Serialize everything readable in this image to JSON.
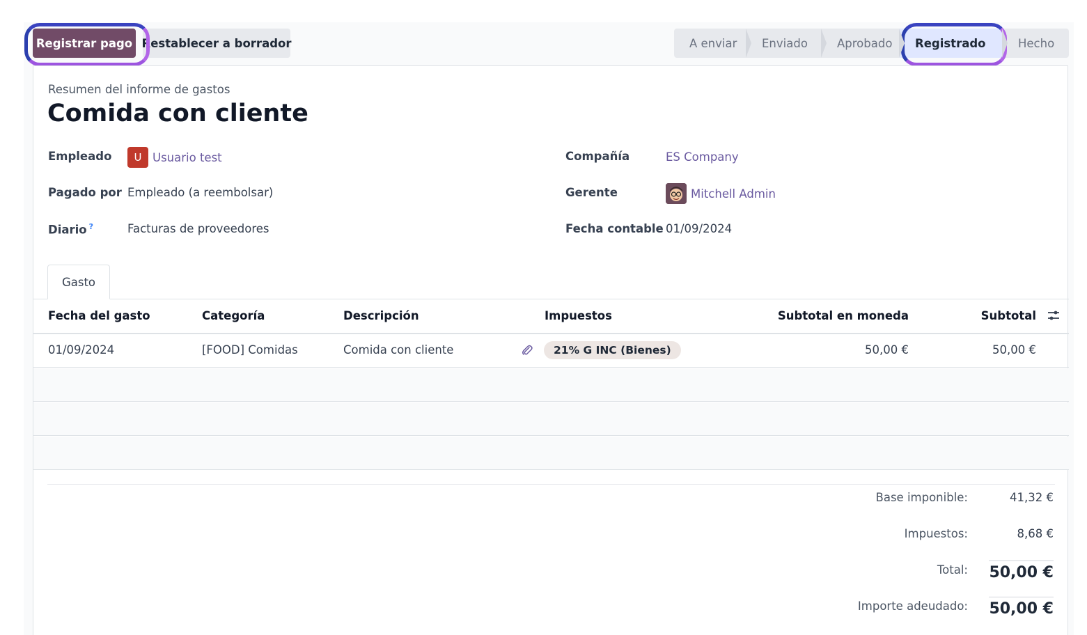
{
  "toolbar": {
    "register_payment": "Registrar pago",
    "reset_to_draft": "Restablecer a borrador"
  },
  "status_bar": {
    "stages": [
      "A enviar",
      "Enviado",
      "Aprobado",
      "Registrado",
      "Hecho"
    ],
    "active": "Registrado"
  },
  "form": {
    "subtitle": "Resumen del informe de gastos",
    "title": "Comida con cliente",
    "fields_left": {
      "employee_label": "Empleado",
      "employee_initial": "U",
      "employee_value": "Usuario test",
      "paid_by_label": "Pagado por",
      "paid_by_value": "Empleado (a reembolsar)",
      "journal_label": "Diario",
      "journal_help": "?",
      "journal_value": "Facturas de proveedores"
    },
    "fields_right": {
      "company_label": "Compañía",
      "company_value": "ES Company",
      "manager_label": "Gerente",
      "manager_value": "Mitchell Admin",
      "accounting_date_label": "Fecha contable",
      "accounting_date_value": "01/09/2024"
    }
  },
  "tabs": [
    {
      "label": "Gasto",
      "active": true
    }
  ],
  "table": {
    "columns": [
      "Fecha del gasto",
      "Categoría",
      "Descripción",
      "Impuestos",
      "Subtotal en moneda",
      "Subtotal"
    ],
    "rows": [
      {
        "date": "01/09/2024",
        "category": "[FOOD] Comidas",
        "description": "Comida con cliente",
        "tax": "21% G INC (Bienes)",
        "subtotal_currency": "50,00 €",
        "subtotal": "50,00 €"
      }
    ]
  },
  "totals": {
    "base_label": "Base imponible:",
    "base_value": "41,32 €",
    "tax_label": "Impuestos:",
    "tax_value": "8,68 €",
    "total_label": "Total:",
    "total_value": "50,00 €",
    "due_label": "Importe adeudado:",
    "due_value": "50,00 €"
  },
  "colors": {
    "primary": "#714b67",
    "link": "#6a5aa0",
    "highlight_ring": "#9d55e0",
    "active_stage_bg": "#e0e7ff"
  }
}
